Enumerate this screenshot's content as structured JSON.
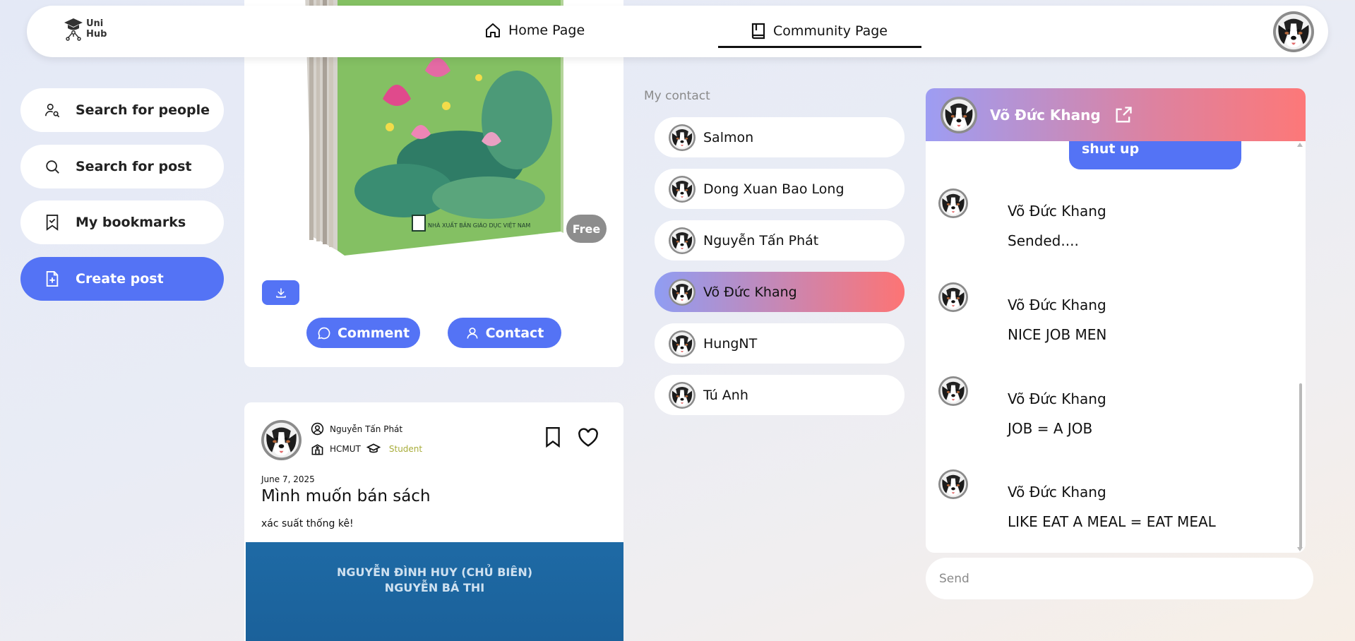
{
  "nav": {
    "logo_line1": "Uni",
    "logo_line2": "Hub",
    "home_label": "Home Page",
    "community_label": "Community Page"
  },
  "sidebar": {
    "items": [
      {
        "label": "Search for people",
        "icon": "user-search-icon"
      },
      {
        "label": "Search for post",
        "icon": "search-icon"
      },
      {
        "label": "My bookmarks",
        "icon": "bookmark-icon"
      },
      {
        "label": "Create post",
        "icon": "file-plus-icon"
      }
    ]
  },
  "post1": {
    "badge": "Free",
    "publisher": "NHÀ XUẤT BẢN GIÁO DỤC VIỆT NAM",
    "comment_label": "Comment",
    "contact_label": "Contact"
  },
  "post2": {
    "author": "Nguyễn Tấn Phát",
    "school": "HCMUT",
    "role": "Student",
    "date": "June 7, 2025",
    "title": "Mình muốn bán sách",
    "description": "xác suất thống kê!",
    "cover_line1": "NGUYỄN ĐÌNH HUY (CHỦ BIÊN)",
    "cover_line2": "NGUYỄN BÁ THI"
  },
  "contacts": {
    "label": "My contact",
    "items": [
      "Salmon",
      "Dong Xuan Bao Long",
      "Nguyễn Tấn Phát",
      "Võ Đức Khang",
      "HungNT",
      "Tú Anh"
    ],
    "active": "Võ Đức Khang"
  },
  "chat": {
    "header_name": "Võ Đức Khang",
    "own_bubble": "shut up",
    "messages": [
      {
        "name": "Võ Đức Khang",
        "text": "Sended...."
      },
      {
        "name": "Võ Đức Khang",
        "text": "NICE JOB MEN"
      },
      {
        "name": "Võ Đức Khang",
        "text": "JOB = A JOB"
      },
      {
        "name": "Võ Đức Khang",
        "text": "LIKE EAT A MEAL = EAT MEAL"
      }
    ],
    "input_placeholder": "Send"
  },
  "colors": {
    "accent": "#5473f5",
    "free_badge": "#8d8d8d",
    "student": "#a8ad3a",
    "active_gradient_start": "#8f9df3",
    "active_gradient_end": "#fd7474"
  }
}
